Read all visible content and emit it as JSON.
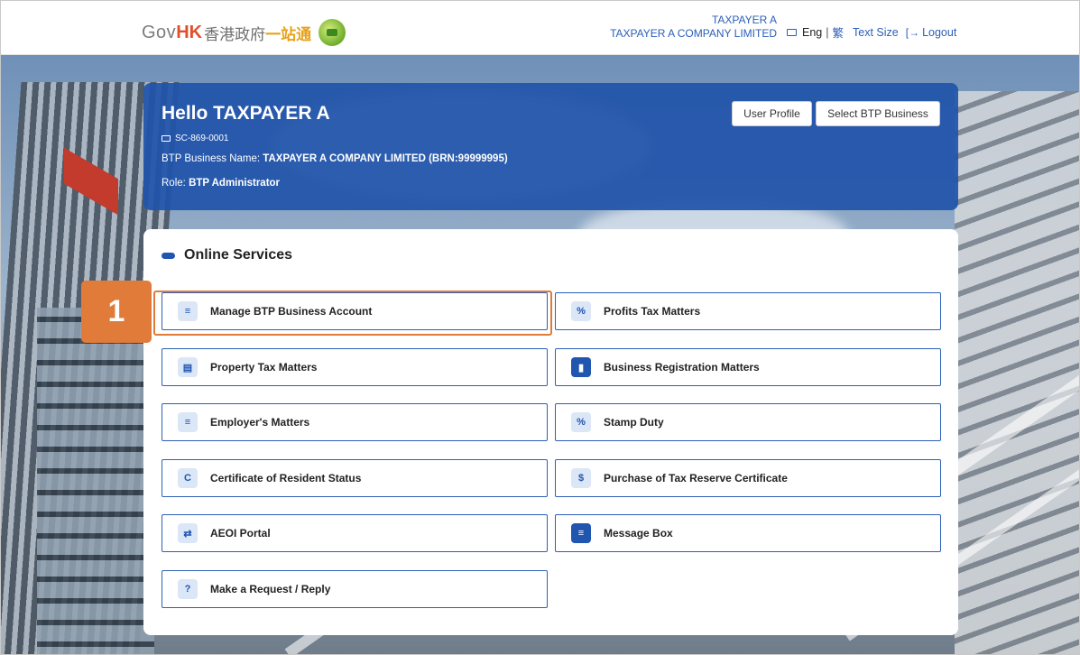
{
  "header": {
    "logo_gov": "Gov",
    "logo_hk": "HK",
    "logo_zh": "香港政府",
    "logo_zh2": "一站通",
    "user_name": "TAXPAYER A",
    "company_name": "TAXPAYER A COMPANY LIMITED",
    "lang_eng": "Eng",
    "lang_sep": "|",
    "lang_zh": "繁",
    "text_size": "Text Size",
    "logout": "Logout",
    "logout_glyph": "[→"
  },
  "banner": {
    "greeting": "Hello TAXPAYER A",
    "account_id": "SC-869-0001",
    "business_label": "BTP Business Name:",
    "business_value": "TAXPAYER A COMPANY LIMITED (BRN:99999995)",
    "role_label": "Role:",
    "role_value": "BTP Administrator",
    "btn_profile": "User Profile",
    "btn_select": "Select BTP Business"
  },
  "services": {
    "title": "Online Services",
    "items": [
      {
        "label": "Manage BTP Business Account",
        "icon": "id-card-icon",
        "glyph": "≡"
      },
      {
        "label": "Profits Tax Matters",
        "icon": "percent-document-icon",
        "glyph": "%"
      },
      {
        "label": "Property Tax Matters",
        "icon": "building-person-icon",
        "glyph": "▤"
      },
      {
        "label": "Business Registration Matters",
        "icon": "briefcase-icon",
        "glyph": "▮"
      },
      {
        "label": "Employer's Matters",
        "icon": "list-document-icon",
        "glyph": "≡"
      },
      {
        "label": "Stamp Duty",
        "icon": "percent-icon",
        "glyph": "%"
      },
      {
        "label": "Certificate of Resident Status",
        "icon": "certificate-icon",
        "glyph": "C"
      },
      {
        "label": "Purchase of Tax Reserve Certificate",
        "icon": "dollar-hand-icon",
        "glyph": "$"
      },
      {
        "label": "AEOI Portal",
        "icon": "exchange-icon",
        "glyph": "⇄"
      },
      {
        "label": "Message Box",
        "icon": "message-box-icon",
        "glyph": "≡"
      },
      {
        "label": "Make a Request / Reply",
        "icon": "question-icon",
        "glyph": "?"
      }
    ]
  },
  "callout": {
    "number": "1"
  },
  "colors": {
    "banner_blue": "#2154aa",
    "link_blue": "#2a5fb8",
    "callout_orange": "#e07b39"
  }
}
